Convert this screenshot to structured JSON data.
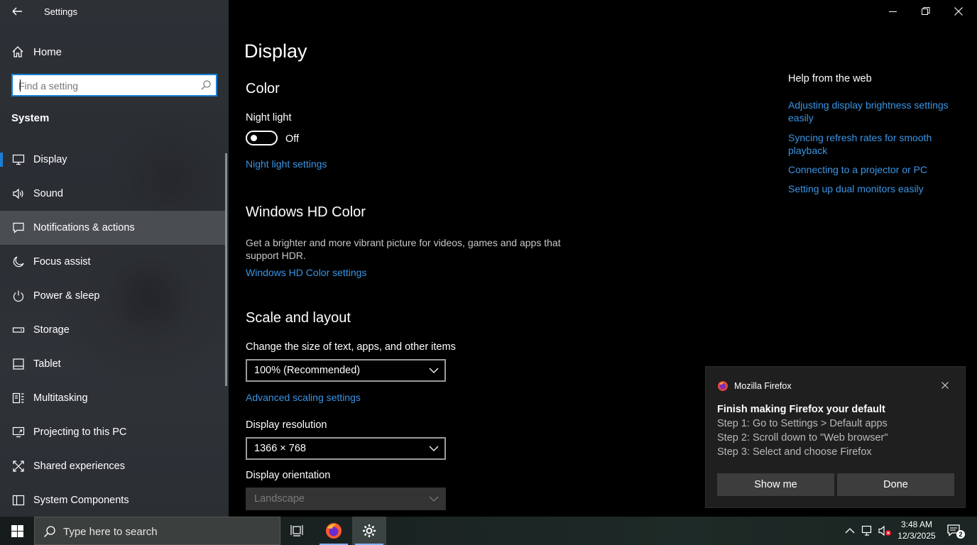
{
  "window": {
    "title": "Settings"
  },
  "sidebar": {
    "home_label": "Home",
    "search_placeholder": "Find a setting",
    "section": "System",
    "items": [
      {
        "label": "Display",
        "icon": "monitor-icon"
      },
      {
        "label": "Sound",
        "icon": "speaker-icon"
      },
      {
        "label": "Notifications & actions",
        "icon": "notification-icon"
      },
      {
        "label": "Focus assist",
        "icon": "moon-icon"
      },
      {
        "label": "Power & sleep",
        "icon": "power-icon"
      },
      {
        "label": "Storage",
        "icon": "storage-icon"
      },
      {
        "label": "Tablet",
        "icon": "tablet-icon"
      },
      {
        "label": "Multitasking",
        "icon": "multitasking-icon"
      },
      {
        "label": "Projecting to this PC",
        "icon": "projecting-icon"
      },
      {
        "label": "Shared experiences",
        "icon": "shared-icon"
      },
      {
        "label": "System Components",
        "icon": "components-icon"
      }
    ]
  },
  "main": {
    "title": "Display",
    "color": {
      "heading": "Color",
      "night_light_label": "Night light",
      "night_light_state": "Off",
      "night_light_link": "Night light settings"
    },
    "hdr": {
      "heading": "Windows HD Color",
      "description": "Get a brighter and more vibrant picture for videos, games and apps that support HDR.",
      "link": "Windows HD Color settings"
    },
    "scale": {
      "heading": "Scale and layout",
      "size_label": "Change the size of text, apps, and other items",
      "size_value": "100% (Recommended)",
      "advanced_link": "Advanced scaling settings",
      "resolution_label": "Display resolution",
      "resolution_value": "1366 × 768",
      "orientation_label": "Display orientation",
      "orientation_value": "Landscape"
    },
    "help": {
      "title": "Help from the web",
      "links": [
        "Adjusting display brightness settings easily",
        "Syncing refresh rates for smooth playback",
        "Connecting to a projector or PC",
        "Setting up dual monitors easily"
      ]
    }
  },
  "toast": {
    "app_name": "Mozilla Firefox",
    "heading": "Finish making Firefox your default",
    "steps": [
      "Step 1: Go to Settings > Default apps",
      "Step 2: Scroll down to \"Web browser\"",
      "Step 3: Select and choose Firefox"
    ],
    "primary_label": "Show me",
    "secondary_label": "Done"
  },
  "taskbar": {
    "search_text": "Type here to search",
    "time": "3:48 AM",
    "date": "12/3/2025",
    "notification_count": "2"
  },
  "colors": {
    "accent": "#1a7fd4",
    "link": "#3a95e6"
  }
}
